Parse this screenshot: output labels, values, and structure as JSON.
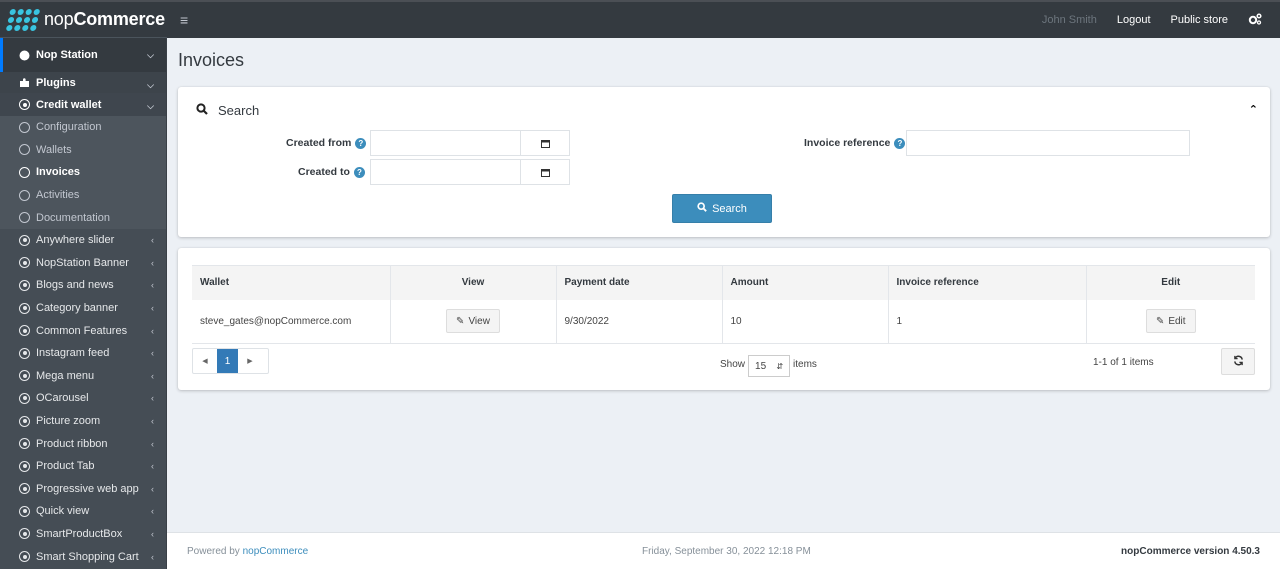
{
  "header": {
    "brand_light": "nop",
    "brand_bold": "Commerce",
    "menu_icon": "hamburger-icon",
    "user_name": "John Smith",
    "logout": "Logout",
    "public_store": "Public store",
    "settings_icon": "gears-icon"
  },
  "sidebar": {
    "top_item": {
      "label": "Nop Station",
      "icon": "circle-icon"
    },
    "plugins": {
      "label": "Plugins",
      "icon": "puzzle-icon"
    },
    "credit_wallet": {
      "label": "Credit wallet",
      "icon": "dot-circle-icon"
    },
    "sub_items": [
      {
        "label": "Configuration",
        "active": false
      },
      {
        "label": "Wallets",
        "active": false
      },
      {
        "label": "Invoices",
        "active": true
      },
      {
        "label": "Activities",
        "active": false
      },
      {
        "label": "Documentation",
        "active": false
      }
    ],
    "plugin_items": [
      {
        "label": "Anywhere slider"
      },
      {
        "label": "NopStation Banner"
      },
      {
        "label": "Blogs and news"
      },
      {
        "label": "Category banner"
      },
      {
        "label": "Common Features"
      },
      {
        "label": "Instagram feed"
      },
      {
        "label": "Mega menu"
      },
      {
        "label": "OCarousel"
      },
      {
        "label": "Picture zoom"
      },
      {
        "label": "Product ribbon"
      },
      {
        "label": "Product Tab"
      },
      {
        "label": "Progressive web app"
      },
      {
        "label": "Quick view"
      },
      {
        "label": "SmartProductBox"
      },
      {
        "label": "Smart Shopping Cart"
      }
    ]
  },
  "page": {
    "title": "Invoices"
  },
  "search": {
    "title": "Search",
    "created_from_label": "Created from",
    "created_from_value": "",
    "created_to_label": "Created to",
    "created_to_value": "",
    "invoice_reference_label": "Invoice reference",
    "invoice_reference_value": "",
    "search_button": "Search"
  },
  "grid": {
    "columns": [
      "Wallet",
      "View",
      "Payment date",
      "Amount",
      "Invoice reference",
      "Edit"
    ],
    "rows": [
      {
        "wallet": "steve_gates@nopCommerce.com",
        "view": "View",
        "payment_date": "9/30/2022",
        "amount": "10",
        "invoice_reference": "1",
        "edit": "Edit"
      }
    ],
    "current_page": "1",
    "show_label": "Show",
    "page_size": "15",
    "items_label": "items",
    "count_text": "1-1 of 1 items"
  },
  "footer": {
    "powered_by": "Powered by ",
    "powered_link": "nopCommerce",
    "datetime": "Friday, September 30, 2022 12:18 PM",
    "version": "nopCommerce version 4.50.3"
  },
  "colors": {
    "accent": "#3c8dbc",
    "sidebar_bg": "#454d55",
    "header_bg": "#343a40",
    "logo": "#39c4e0"
  }
}
